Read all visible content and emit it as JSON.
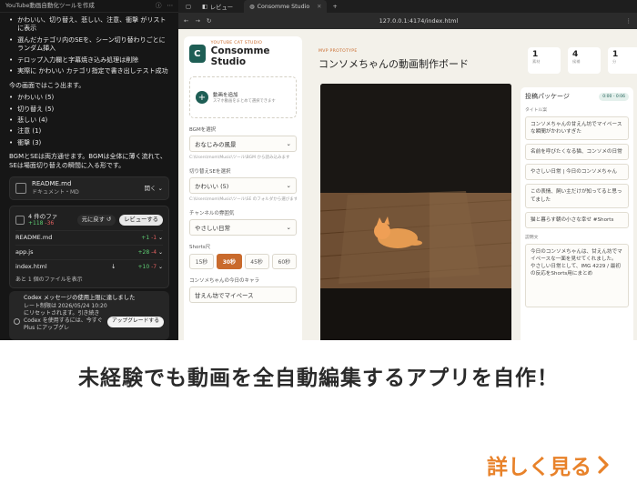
{
  "chat": {
    "title": "YouTube動画自動化ツールを作成",
    "bullets_top": [
      "かわいい、切り替え、悲しい、注意、衝撃 がリストに表示",
      "選んだカテゴリ内のSEを、シーン切り替わりごとにランダム挿入",
      "テロップ入力欄と字幕焼き込み処理は削除",
      "実際に かわいい カテゴリ指定で書き出しテスト成功"
    ],
    "counts_intro": "今の画面ではこう出ます。",
    "counts": [
      "かわいい (5)",
      "切り替え (5)",
      "悲しい (4)",
      "注意 (1)",
      "衝撃 (3)"
    ],
    "bgm_note": "BGMとSEは両方通せます。BGMは全体に薄く流れて、SEは場面切り替えの瞬間に入る形です。",
    "file_card": {
      "name": "README.md",
      "type": "ドキュメント・MD",
      "open": "開く"
    },
    "changes": {
      "title_prefix": "4 件のファ",
      "plus": "+118",
      "minus": "-36",
      "undo": "元に戻す",
      "review": "レビューする",
      "rows": [
        {
          "name": "README.md",
          "plus": "+1",
          "minus": "-1"
        },
        {
          "name": "app.js",
          "plus": "+28",
          "minus": "-4"
        },
        {
          "name": "index.html",
          "plus": "+10",
          "minus": "-7"
        }
      ],
      "more": "あと 1 個のファイルを表示"
    },
    "limit": {
      "heading": "Codex メッセージの使用上限に達しました",
      "body": "レート制限は 2026/05/24 10:20にリセットされます。引き続き Codex を使用するには、今すぐ Plus にアップグレ",
      "upgrade": "アップグレードする"
    }
  },
  "browser": {
    "tabs": [
      "レビュー",
      "Consomme Studio"
    ],
    "url": "127.0.0.1:4174/index.html"
  },
  "app": {
    "brand_sub": "YOUTUBE CAT STUDIO",
    "brand_name": "Consomme Studio",
    "logo_letter": "C",
    "add_title": "動画を追加",
    "add_sub": "スマホ動画をまとめて選択できます",
    "bgm_label": "BGMを選択",
    "bgm_value": "おなじみの風景",
    "bgm_path": "C:\\Users\\mom\\Music\\ツール\\BGM から読み込みます",
    "se_label": "切り替えSEを選択",
    "se_value": "かわいい (5)",
    "se_path": "C:\\Users\\mom\\Music\\ツール\\SE のフォルダから選びます",
    "channel_label": "チャンネルの雰囲気",
    "channel_value": "やさしい日常",
    "shorts_label": "Shorts尺",
    "durations": [
      "15秒",
      "30秒",
      "45秒",
      "60秒"
    ],
    "duration_selected": "30秒",
    "caption_label": "コンソメちゃんの今日のキャラ",
    "caption_value": "甘えん坊でマイペース",
    "mp_sub": "MVP PROTOTYPE",
    "mp_title": "コンソメちゃんの動画制作ボード",
    "stats": [
      {
        "n": "1",
        "l": "素材"
      },
      {
        "n": "4",
        "l": "候補"
      },
      {
        "n": "1",
        "l": "分"
      }
    ],
    "posts_title": "投稿パッケージ",
    "posts_badge": "0:00 - 0:06",
    "title_label": "タイトル案",
    "titles": [
      "コンソメちゃんの甘えん坊でマイペースな瞬間がかわいすぎた",
      "名前を呼びたくなる猫、コンソメの日常",
      "やさしい日常 | 今日のコンソメちゃん",
      "この表情、飼い主だけが知ってると思ってました",
      "猫と暮らす朝の小さな幸せ #Shorts"
    ],
    "desc_label": "説明文",
    "desc": "今日のコンソメちゃんは、甘えん坊でマイペースな一面を見せてくれました。\nやさしい日常として、IMG 4229 / 最初の反応をShorts用にまとめ"
  },
  "caption": {
    "headline": "未経験でも動画を全自動編集するアプリを自作！",
    "more": "詳しく見る"
  },
  "colors": {
    "accent": "#e8822a",
    "brand": "#1e5e55"
  }
}
